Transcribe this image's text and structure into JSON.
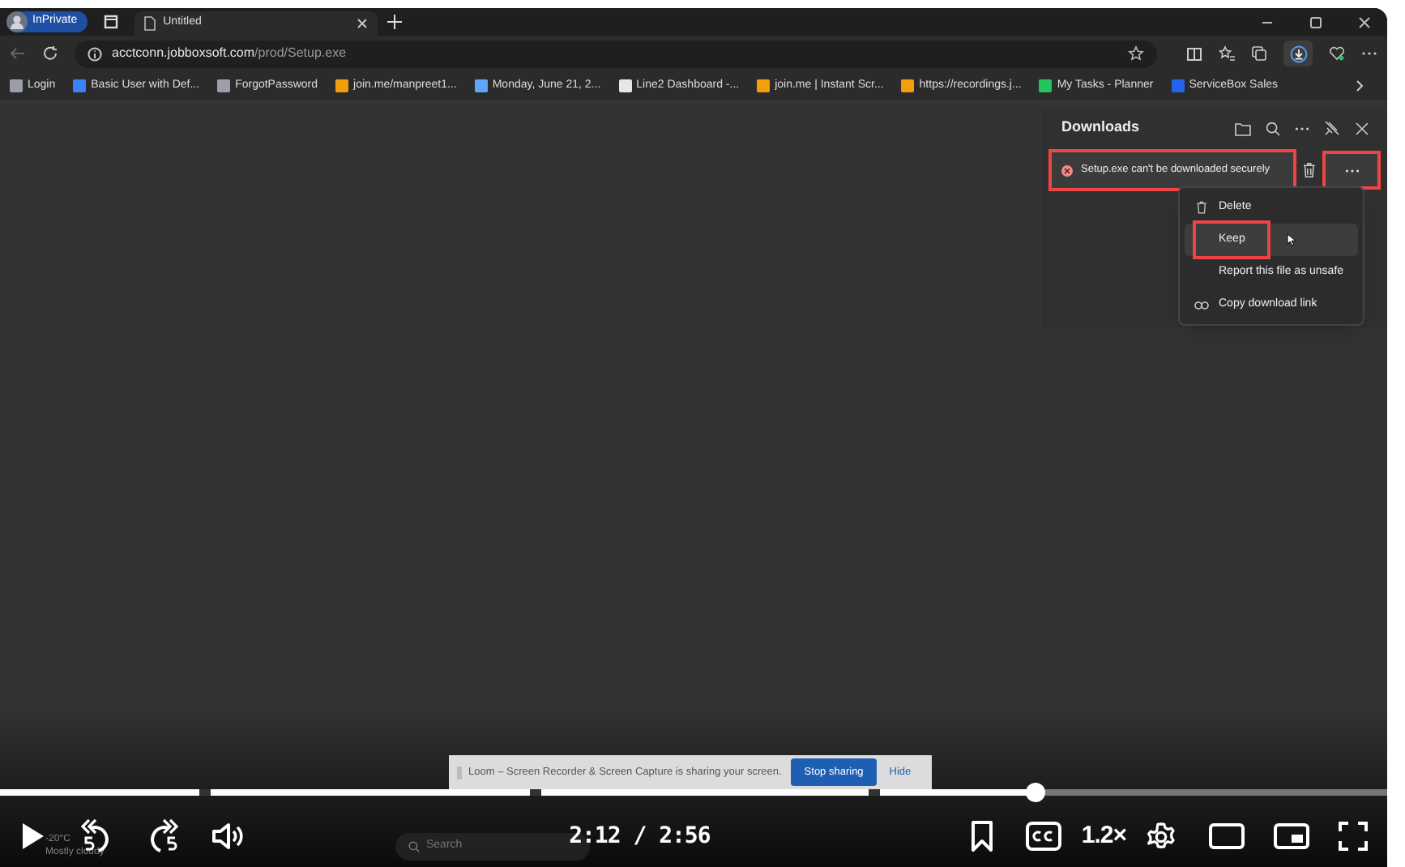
{
  "browser": {
    "profile": "InPrivate",
    "tabs": [
      {
        "title": "Untitled",
        "selected": true
      }
    ],
    "address": {
      "host": "acctconn.jobboxsoft.com",
      "path": "/prod/Setup.exe"
    },
    "bookmarks": [
      {
        "label": "Login",
        "color": "#9aa0a6"
      },
      {
        "label": "Basic User with Def...",
        "color": "#3b82f6"
      },
      {
        "label": "ForgotPassword",
        "color": "#9aa0a6"
      },
      {
        "label": "join.me/manpreet1...",
        "color": "#f59e0b"
      },
      {
        "label": "Monday, June 21, 2...",
        "color": "#60a5fa"
      },
      {
        "label": "Line2 Dashboard -...",
        "color": "#e5e7eb"
      },
      {
        "label": "join.me | Instant Scr...",
        "color": "#f59e0b"
      },
      {
        "label": "https://recordings.j...",
        "color": "#f59e0b"
      },
      {
        "label": "My Tasks - Planner",
        "color": "#22c55e"
      },
      {
        "label": "ServiceBox Sales",
        "color": "#2563eb"
      }
    ]
  },
  "downloads": {
    "title": "Downloads",
    "items": [
      {
        "text": "Setup.exe can't be downloaded securely",
        "kind": "error",
        "highlighted": true
      }
    ],
    "more_highlighted": true,
    "menu": [
      {
        "label": "Delete",
        "kind": "delete",
        "hovered": false,
        "highlighted": false
      },
      {
        "label": "Keep",
        "kind": "keep",
        "hovered": true,
        "highlighted": true
      },
      {
        "label": "Report this file as unsafe",
        "kind": "report",
        "hovered": false,
        "highlighted": false
      },
      {
        "label": "Copy download link",
        "kind": "copy",
        "hovered": false,
        "highlighted": false
      }
    ]
  },
  "banner": {
    "message": "Loom – Screen Recorder & Screen Capture is sharing your screen.",
    "buttons": [
      {
        "label": "Stop sharing",
        "primary": true
      },
      {
        "label": "Hide",
        "primary": false
      }
    ]
  },
  "taskbar": {
    "weather": "-20°C",
    "forecast": "Mostly cloudy",
    "search": "Search"
  },
  "player": {
    "level": 0.747,
    "time": "2:12 / 2:56",
    "speed": "1.2×",
    "playing": false
  }
}
